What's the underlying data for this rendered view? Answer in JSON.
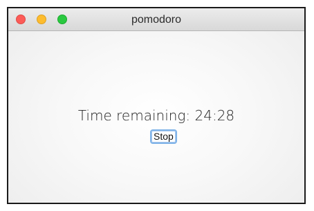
{
  "window": {
    "title": "pomodoro"
  },
  "timer": {
    "label": "Time remaining:",
    "value": "24:28",
    "display": "Time remaining: 24:28"
  },
  "controls": {
    "stop_label": "Stop"
  },
  "icons": {
    "close": "close-traffic-light",
    "minimize": "minimize-traffic-light",
    "zoom": "zoom-traffic-light"
  },
  "colors": {
    "close": "#fc5b57",
    "minimize": "#fdbc2e",
    "zoom": "#2ac840",
    "focus_ring": "#7fb3e8"
  }
}
